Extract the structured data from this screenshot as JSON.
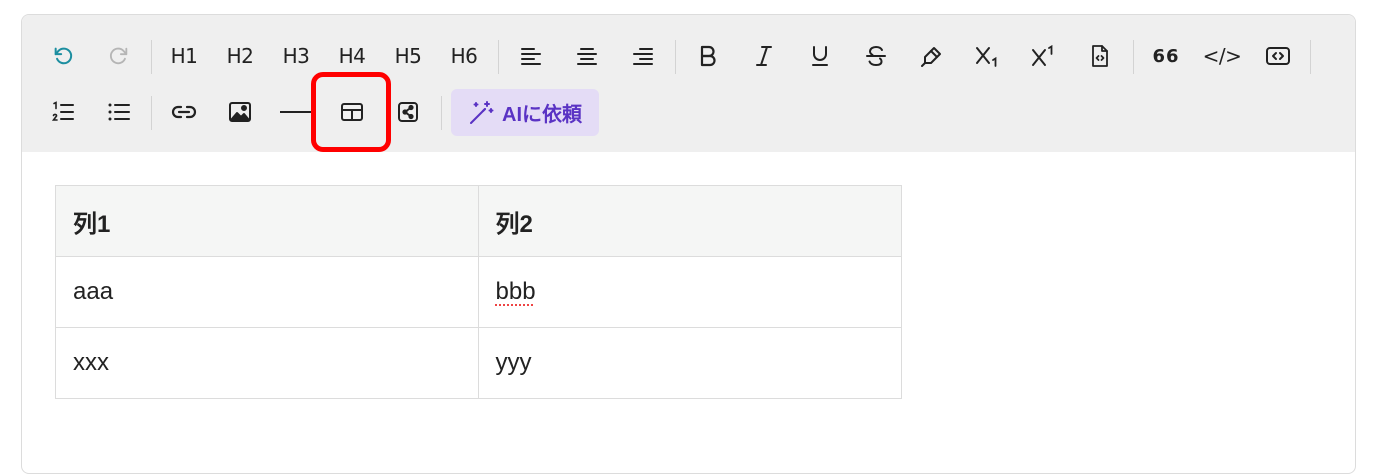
{
  "toolbar": {
    "row1": {
      "undo_icon": "undo-icon",
      "redo_icon": "redo-icon",
      "headings": [
        "H1",
        "H2",
        "H3",
        "H4",
        "H5",
        "H6"
      ],
      "align_icons": [
        "align-left-icon",
        "align-center-icon",
        "align-right-icon"
      ],
      "format_icons": [
        "bold-icon",
        "italic-icon",
        "underline-icon",
        "strikethrough-icon",
        "highlighter-icon",
        "subscript-icon",
        "superscript-icon",
        "code-file-icon"
      ],
      "quote_label": "66",
      "code_label": "</>",
      "embed_icon": "code-block-icon"
    },
    "row2": {
      "icons": [
        "ordered-list-icon",
        "bullet-list-icon",
        "link-icon",
        "image-icon",
        "horizontal-rule-icon",
        "table-icon",
        "share-icon"
      ],
      "ai_button_label": "AIに依頼",
      "ai_icon": "magic-wand-icon"
    },
    "highlight_color": "#ff0000",
    "ai_accent": "#5a33c4"
  },
  "table": {
    "headers": [
      "列1",
      "列2"
    ],
    "rows": [
      [
        "aaa",
        "bbb"
      ],
      [
        "xxx",
        "yyy"
      ]
    ]
  }
}
